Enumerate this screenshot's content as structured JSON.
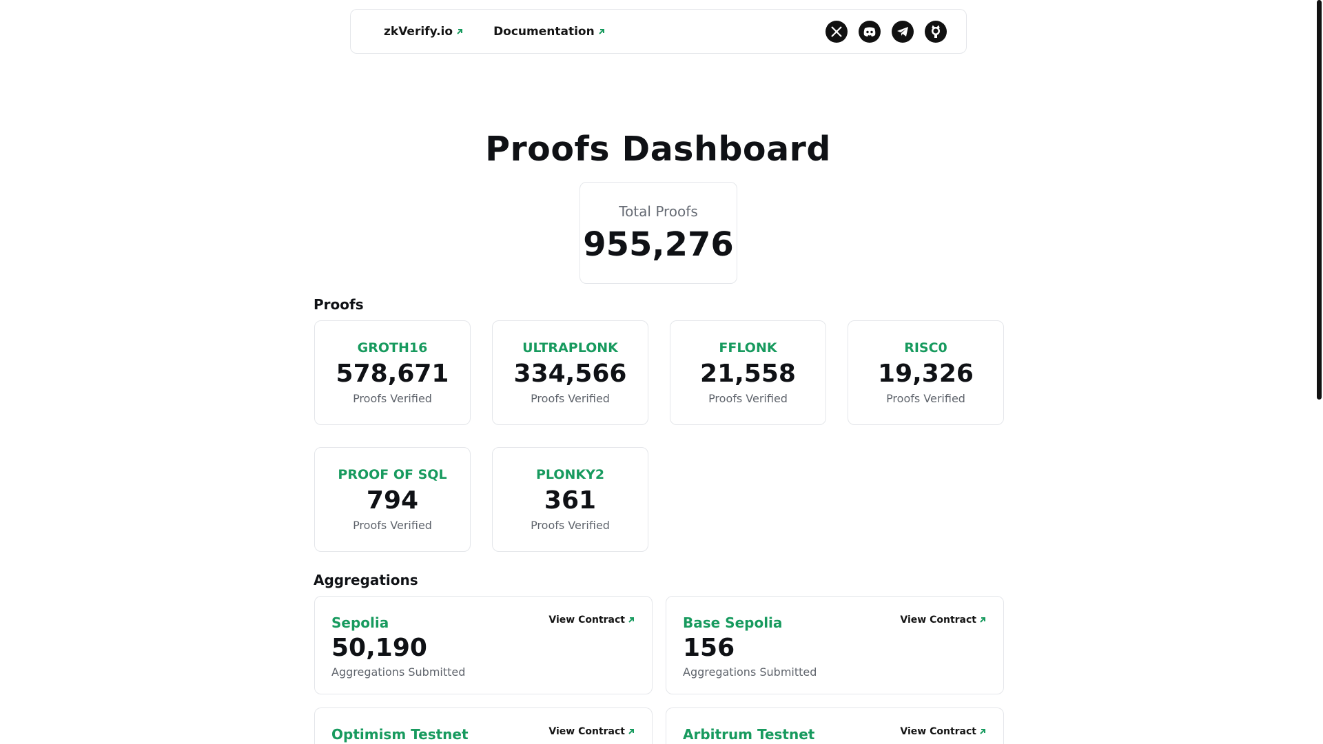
{
  "nav": {
    "links": [
      {
        "label": "zkVerify.io"
      },
      {
        "label": "Documentation"
      }
    ],
    "social": [
      "x-icon",
      "discord-icon",
      "telegram-icon",
      "github-icon"
    ]
  },
  "page": {
    "title": "Proofs Dashboard"
  },
  "total": {
    "label": "Total Proofs",
    "value": "955,276"
  },
  "sections": {
    "proofs": "Proofs",
    "aggregations": "Aggregations"
  },
  "proofs": [
    {
      "name": "GROTH16",
      "value": "578,671",
      "sub": "Proofs Verified"
    },
    {
      "name": "ULTRAPLONK",
      "value": "334,566",
      "sub": "Proofs Verified"
    },
    {
      "name": "FFLONK",
      "value": "21,558",
      "sub": "Proofs Verified"
    },
    {
      "name": "RISC0",
      "value": "19,326",
      "sub": "Proofs Verified"
    },
    {
      "name": "PROOF OF SQL",
      "value": "794",
      "sub": "Proofs Verified"
    },
    {
      "name": "PLONKY2",
      "value": "361",
      "sub": "Proofs Verified"
    }
  ],
  "aggregations": [
    {
      "name": "Sepolia",
      "value": "50,190",
      "sub": "Aggregations Submitted",
      "link": "View Contract"
    },
    {
      "name": "Base Sepolia",
      "value": "156",
      "sub": "Aggregations Submitted",
      "link": "View Contract"
    },
    {
      "name": "Optimism Testnet",
      "value": "",
      "sub": "",
      "link": "View Contract"
    },
    {
      "name": "Arbitrum Testnet",
      "value": "",
      "sub": "",
      "link": "View Contract"
    }
  ],
  "colors": {
    "accent": "#179a5e",
    "text": "#0f1115",
    "muted": "#5f646c",
    "border": "#e4e6ea"
  }
}
